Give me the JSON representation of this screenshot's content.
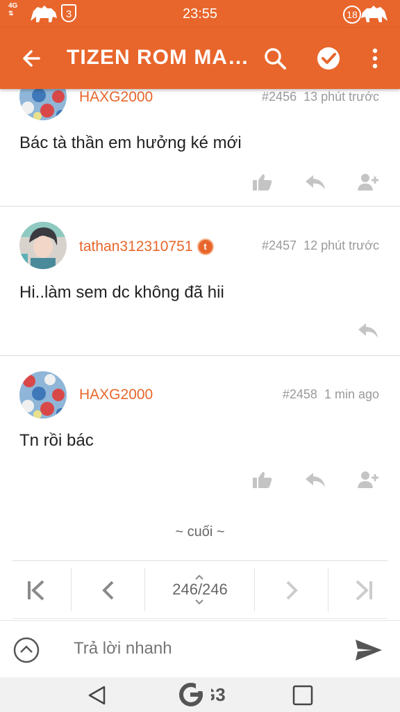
{
  "status_bar": {
    "time": "23:55",
    "network": "4G",
    "left_badge": "3",
    "right_badge": "18"
  },
  "app_bar": {
    "title": "TIZEN ROM MA…",
    "icons": [
      "back-arrow-icon",
      "search-icon",
      "check-circle-icon",
      "more-vert-icon"
    ]
  },
  "posts": [
    {
      "username": "HAXG2000",
      "post_number": "#2456",
      "time": "13 phút trước",
      "message": "Bác tà thần em hưởng ké mới",
      "actions": [
        "like-icon",
        "reply-icon",
        "add-user-icon"
      ]
    },
    {
      "username": "tathan312310751",
      "badge": "t",
      "post_number": "#2457",
      "time": "12 phút trước",
      "message": "Hi..làm sem dc không đã hii",
      "actions": [
        "reply-icon"
      ]
    },
    {
      "username": "HAXG2000",
      "post_number": "#2458",
      "time": "1 min ago",
      "message": "Tn rồi bác",
      "actions": [
        "like-icon",
        "reply-icon",
        "add-user-icon"
      ]
    }
  ],
  "end_label": "~ cuối ~",
  "pagination": {
    "current_page": 246,
    "total_pages": 246,
    "label": "246/246"
  },
  "composer": {
    "placeholder": "Trả lời nhanh",
    "value": ""
  },
  "nav_bar": {
    "logo": "G3",
    "icons": [
      "back-triangle-icon",
      "home-logo",
      "recent-apps-icon"
    ]
  },
  "colors": {
    "accent": "#e8662c",
    "muted": "#9a9a9a",
    "icon_gray": "#c4c4c4"
  }
}
